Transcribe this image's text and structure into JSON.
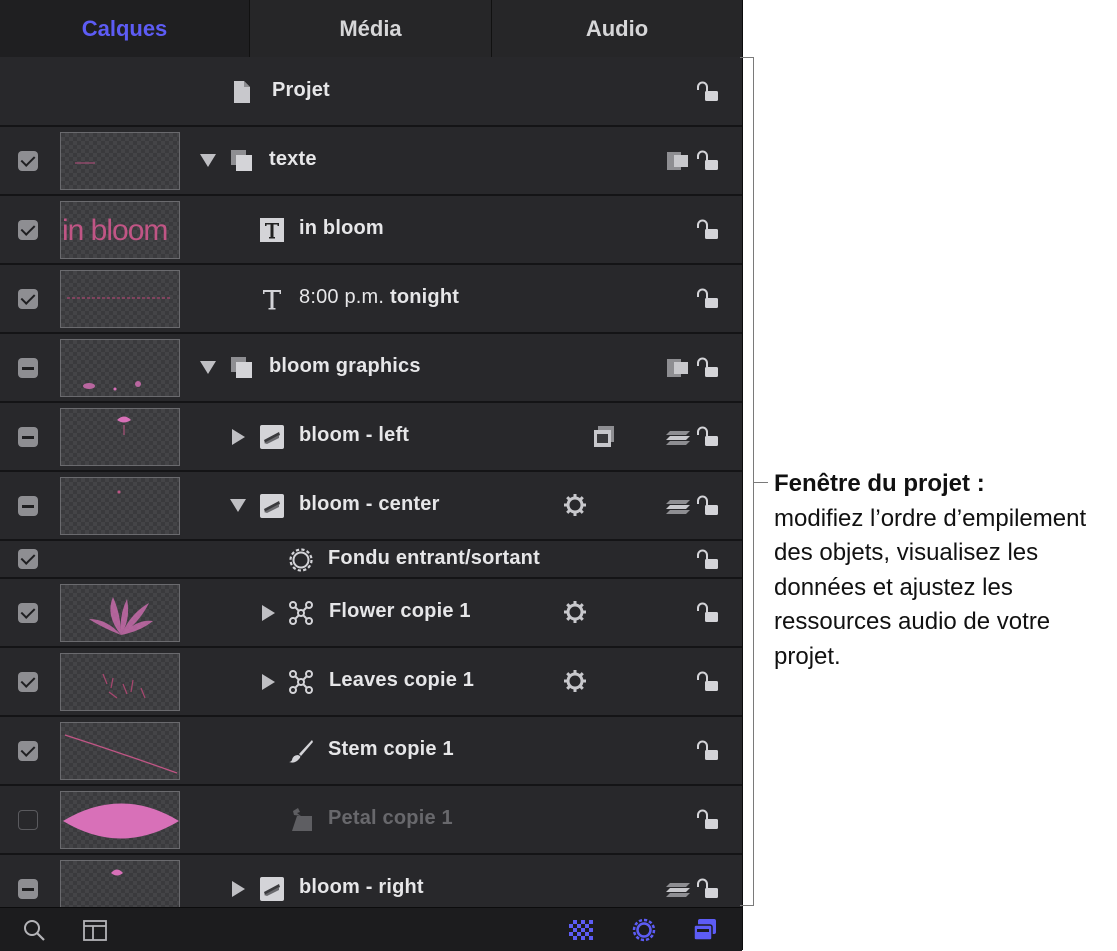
{
  "tabs": [
    {
      "label": "Calques",
      "active": true
    },
    {
      "label": "Média",
      "active": false
    },
    {
      "label": "Audio",
      "active": false
    }
  ],
  "project_row": {
    "name": "Projet"
  },
  "layers": [
    {
      "name": "texte",
      "check": "checked"
    },
    {
      "name": "in bloom",
      "check": "checked"
    },
    {
      "name": "8:00 p.m.",
      "name_bold": "tonight",
      "check": "checked"
    },
    {
      "name": "bloom graphics",
      "check": "mixed"
    },
    {
      "name": "bloom - left",
      "check": "mixed"
    },
    {
      "name": "bloom - center",
      "check": "mixed"
    },
    {
      "name": "Fondu entrant/sortant",
      "check": "checked"
    },
    {
      "name": "Flower copie 1",
      "check": "checked"
    },
    {
      "name": "Leaves copie 1",
      "check": "checked"
    },
    {
      "name": "Stem copie 1",
      "check": "checked"
    },
    {
      "name": "Petal copie 1",
      "check": "unchecked"
    },
    {
      "name": "bloom - right",
      "check": "mixed"
    }
  ],
  "thumbnails": {
    "in_bloom_text": "in bloom"
  },
  "callout": {
    "title": "Fenêtre du projet :",
    "body": "modifiez l’ordre d’empilement des objets, visualisez les données et ajustez les ressources audio de votre projet."
  },
  "colors": {
    "accent": "#5d5cf5",
    "panel_bg": "#1f1f21",
    "row_bg": "#28282b",
    "thumb_pink": "#d870b8"
  }
}
